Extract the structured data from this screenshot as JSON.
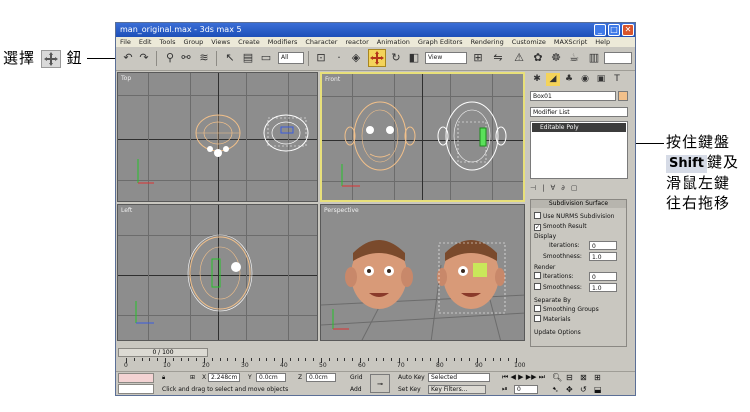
{
  "callouts": {
    "left": {
      "before": "選擇",
      "after": "鈕",
      "icon": "move-icon"
    },
    "right": {
      "line1": "按住鍵盤",
      "shift": "Shift",
      "line2_rest": "鍵及",
      "line3": "滑鼠左鍵",
      "line4": "往右拖移"
    }
  },
  "window": {
    "title": "man_original.max - 3ds max 5",
    "menu": [
      "File",
      "Edit",
      "Tools",
      "Group",
      "Views",
      "Create",
      "Modifiers",
      "Character",
      "reactor",
      "Animation",
      "Graph Editors",
      "Rendering",
      "Customize",
      "MAXScript",
      "Help"
    ],
    "toolbar": {
      "view_combo": "View",
      "selection_combo": "All"
    },
    "viewports": {
      "top": "Top",
      "front": "Front",
      "left": "Left",
      "perspective": "Perspective"
    },
    "command_panel": {
      "object_name": "Box01",
      "modifier_list": "Modifier List",
      "stack_item": "Editable Poly",
      "rollout_title": "Subdivision Surface",
      "use_nurms": "Use NURMS Subdivision",
      "smooth_result": "Smooth Result",
      "display_label": "Display",
      "iterations_label": "Iterations:",
      "iterations_value": "0",
      "smoothness_label": "Smoothness:",
      "smoothness_value": "1.0",
      "render_label": "Render",
      "render_iterations": "0",
      "render_smoothness": "1.0",
      "separate_label": "Separate By",
      "smoothing_groups": "Smoothing Groups",
      "materials": "Materials",
      "update_label": "Update Options"
    },
    "timeline": {
      "frame_counter": "0 / 100",
      "ticks": [
        "0",
        "10",
        "20",
        "30",
        "40",
        "50",
        "60",
        "70",
        "80",
        "90",
        "100"
      ]
    },
    "status": {
      "message": "Click and drag to select and move objects",
      "x_label": "X",
      "x_value": "2.248cm",
      "y_label": "Y",
      "y_value": "0.0cm",
      "z_label": "Z",
      "z_value": "0.0cm",
      "grid": "Grid",
      "add": "Add",
      "auto_key": "Auto Key",
      "selected": "Selected",
      "set_key": "Set Key",
      "key_filters": "Key Filters...",
      "frame": "0"
    }
  },
  "colors": {
    "title_blue": "#1d4fb8",
    "active_viewport_border": "#e8e07a",
    "selected_wire": "#f2c08a",
    "active_tool": "#f4d35a"
  }
}
